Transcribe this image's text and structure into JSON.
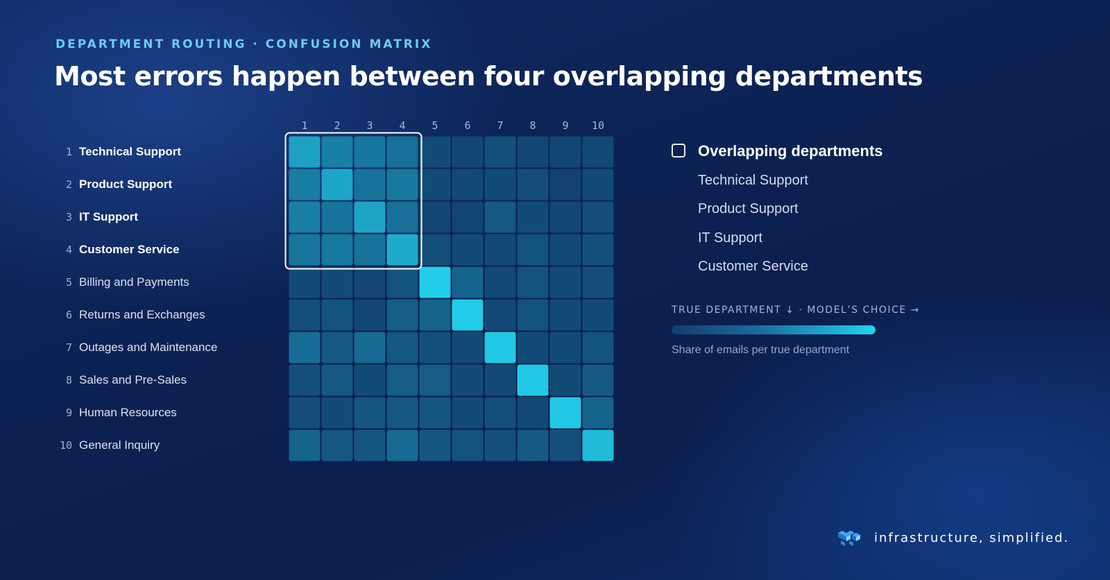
{
  "header": {
    "eyebrow": "DEPARTMENT ROUTING · CONFUSION MATRIX",
    "title": "Most errors happen between four overlapping departments"
  },
  "legend": {
    "title": "Overlapping departments",
    "items": [
      "Technical Support",
      "Product Support",
      "IT Support",
      "Customer Service"
    ],
    "axis_note": "TRUE DEPARTMENT ↓ · MODEL’S CHOICE →",
    "scale_caption": "Share of emails per true department"
  },
  "brand": {
    "text": "infrastructure, simplified.",
    "icon": "stacked-cubes-logo-icon"
  },
  "colors": {
    "accent": "#22d3ee",
    "cell_low": "#123d6b",
    "highlight_box": "#ffffff",
    "eyebrow": "#6ecbf2"
  },
  "chart_data": {
    "type": "heatmap",
    "title": "Most errors happen between four overlapping departments",
    "x_axis_label": "MODEL’S CHOICE",
    "y_axis_label": "TRUE DEPARTMENT",
    "columns": [
      "1",
      "2",
      "3",
      "4",
      "5",
      "6",
      "7",
      "8",
      "9",
      "10"
    ],
    "rows": [
      {
        "num": "1",
        "label": "Technical Support"
      },
      {
        "num": "2",
        "label": "Product Support"
      },
      {
        "num": "3",
        "label": "IT Support"
      },
      {
        "num": "4",
        "label": "Customer Service"
      },
      {
        "num": "5",
        "label": "Billing and Payments"
      },
      {
        "num": "6",
        "label": "Returns and Exchanges"
      },
      {
        "num": "7",
        "label": "Outages and Maintenance"
      },
      {
        "num": "8",
        "label": "Sales and Pre-Sales"
      },
      {
        "num": "9",
        "label": "Human Resources"
      },
      {
        "num": "10",
        "label": "General Inquiry"
      }
    ],
    "highlighted_group": [
      1,
      2,
      3,
      4
    ],
    "values": [
      [
        0.62,
        0.38,
        0.33,
        0.28,
        0.06,
        0.03,
        0.08,
        0.04,
        0.03,
        0.05
      ],
      [
        0.36,
        0.66,
        0.3,
        0.34,
        0.06,
        0.05,
        0.06,
        0.07,
        0.02,
        0.06
      ],
      [
        0.38,
        0.3,
        0.64,
        0.28,
        0.03,
        0.03,
        0.14,
        0.06,
        0.04,
        0.07
      ],
      [
        0.32,
        0.34,
        0.3,
        0.7,
        0.08,
        0.06,
        0.05,
        0.1,
        0.05,
        0.08
      ],
      [
        0.06,
        0.06,
        0.03,
        0.1,
        0.95,
        0.2,
        0.05,
        0.1,
        0.06,
        0.07
      ],
      [
        0.08,
        0.1,
        0.04,
        0.16,
        0.2,
        0.95,
        0.05,
        0.1,
        0.05,
        0.06
      ],
      [
        0.26,
        0.14,
        0.24,
        0.13,
        0.08,
        0.05,
        0.92,
        0.06,
        0.06,
        0.1
      ],
      [
        0.08,
        0.14,
        0.06,
        0.16,
        0.16,
        0.06,
        0.05,
        0.92,
        0.06,
        0.14
      ],
      [
        0.07,
        0.06,
        0.12,
        0.13,
        0.12,
        0.06,
        0.08,
        0.05,
        0.92,
        0.2
      ],
      [
        0.2,
        0.13,
        0.12,
        0.24,
        0.12,
        0.1,
        0.08,
        0.14,
        0.08,
        0.82
      ]
    ],
    "color_scale": [
      "#123d6b",
      "#22d3ee"
    ],
    "grid": false
  }
}
